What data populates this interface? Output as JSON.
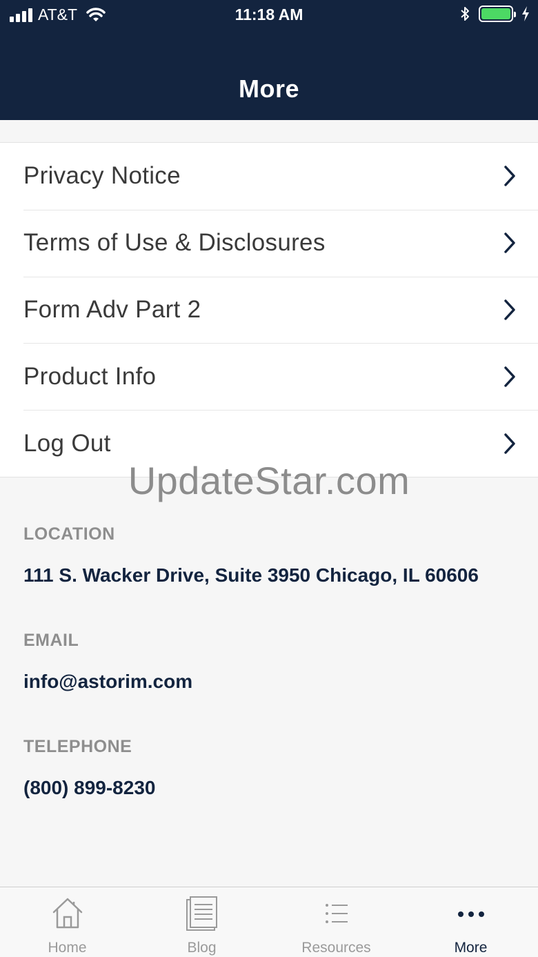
{
  "status_bar": {
    "carrier": "AT&T",
    "time": "11:18 AM",
    "battery_level": 1.0,
    "icons": [
      "signal-icon",
      "wifi-icon",
      "bluetooth-icon",
      "battery-icon",
      "charging-icon"
    ]
  },
  "header": {
    "title": "More"
  },
  "menu": {
    "items": [
      {
        "label": "Privacy Notice"
      },
      {
        "label": "Terms of Use & Disclosures"
      },
      {
        "label": "Form Adv Part 2"
      },
      {
        "label": "Product Info"
      },
      {
        "label": "Log Out"
      }
    ]
  },
  "watermark": "UpdateStar.com",
  "info": {
    "location_label": "LOCATION",
    "location_value": "111 S. Wacker Drive, Suite 3950 Chicago, IL 60606",
    "email_label": "EMAIL",
    "email_value": "info@astorim.com",
    "telephone_label": "TELEPHONE",
    "telephone_value": "(800) 899-8230"
  },
  "tabbar": {
    "tabs": [
      {
        "label": "Home",
        "icon": "home-icon"
      },
      {
        "label": "Blog",
        "icon": "document-icon"
      },
      {
        "label": "Resources",
        "icon": "list-icon"
      },
      {
        "label": "More",
        "icon": "more-dots-icon",
        "active": true
      }
    ]
  },
  "colors": {
    "header_bg": "#13243f",
    "accent": "#13243f",
    "battery": "#4cd964",
    "muted_label": "#8e8e8e"
  }
}
